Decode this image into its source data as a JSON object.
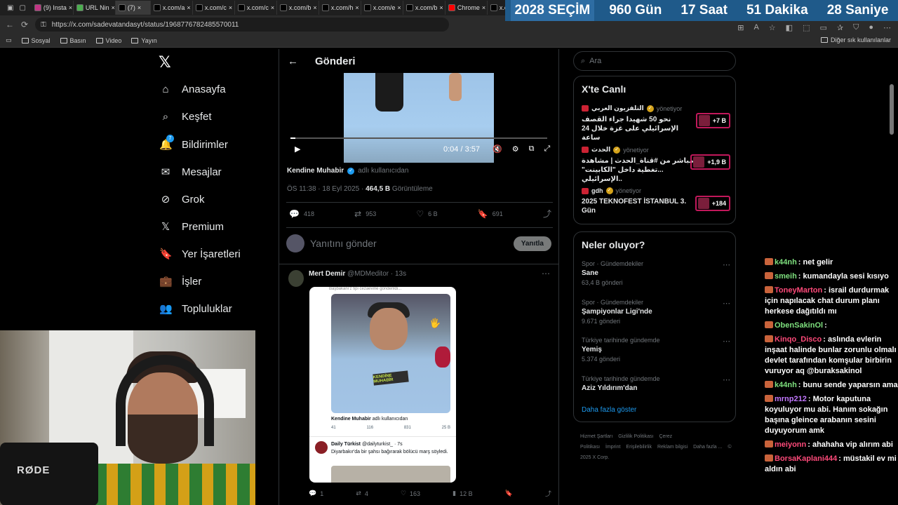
{
  "browser": {
    "tabs": [
      {
        "label": "(9) Insta",
        "color": "#c13584"
      },
      {
        "label": "URL Nin",
        "color": "#4caf50"
      },
      {
        "label": "(7)",
        "color": "#000000"
      },
      {
        "label": "x.com/a",
        "color": "#000000"
      },
      {
        "label": "x.com/c",
        "color": "#000000"
      },
      {
        "label": "x.com/c",
        "color": "#000000"
      },
      {
        "label": "x.com/b",
        "color": "#000000"
      },
      {
        "label": "x.com/h",
        "color": "#000000"
      },
      {
        "label": "x.com/e",
        "color": "#000000"
      },
      {
        "label": "x.com/b",
        "color": "#000000"
      },
      {
        "label": "Chrome",
        "color": "#ff0000"
      },
      {
        "label": "x.com/a",
        "color": "#000000"
      },
      {
        "label": "x.com/u",
        "color": "#000000"
      }
    ],
    "url": "https://x.com/sadevatandasyt/status/1968776782485570011",
    "bookmarks": [
      "Sosyal",
      "Basın",
      "Video",
      "Yayın"
    ],
    "bookmarks_other": "Diğer sık kullanılanlar"
  },
  "election": {
    "label": "2028 SEÇİM",
    "days": "960 Gün",
    "hours": "17 Saat",
    "minutes": "51 Dakika",
    "seconds": "28 Saniye"
  },
  "nav": {
    "items": [
      {
        "label": "Anasayfa",
        "icon": "home-icon",
        "glyph": "⌂"
      },
      {
        "label": "Keşfet",
        "icon": "search-icon",
        "glyph": "⌕"
      },
      {
        "label": "Bildirimler",
        "icon": "bell-icon",
        "glyph": "🔔"
      },
      {
        "label": "Mesajlar",
        "icon": "mail-icon",
        "glyph": "✉"
      },
      {
        "label": "Grok",
        "icon": "grok-icon",
        "glyph": "⊘"
      },
      {
        "label": "Premium",
        "icon": "x-premium-icon",
        "glyph": "𝕏"
      },
      {
        "label": "Yer İşaretleri",
        "icon": "bookmark-icon",
        "glyph": "🔖"
      },
      {
        "label": "İşler",
        "icon": "briefcase-icon",
        "glyph": "💼"
      },
      {
        "label": "Topluluklar",
        "icon": "people-icon",
        "glyph": "👥"
      }
    ],
    "notification_badge": "7"
  },
  "post": {
    "header": "Gönderi",
    "time": "0:04 / 3:57",
    "progress": 0.02,
    "author": "Kendine Muhabir",
    "handle_note": "adlı kullanıcıdan",
    "timestamp": "ÖS 11:38 · 18 Eyl 2025 ·",
    "views": "464,5 B",
    "views_label": "Görüntüleme",
    "replies": "418",
    "reposts": "953",
    "likes": "6 B",
    "bookmarks": "691",
    "reply_placeholder": "Yanıtını gönder",
    "reply_button": "Yanıtla"
  },
  "reply_tweet": {
    "name": "Mert Demir",
    "handle": "@MDMeditor · 13s",
    "embed_top": "Başbakanı'z tipi cezaevine gönderildi...",
    "embed_tag": "KENDİNE MUHABİR",
    "embed_author": "Kendine Muhabir",
    "embed_note": "adlı kullanıcıdan",
    "embed_stats": [
      "41",
      "116",
      "831",
      "25 B"
    ],
    "embed_quoted_name": "Daily Türkist",
    "embed_quoted_handle": "@dailyturkist_ · 7s",
    "embed_quoted_text": "Diyarbakır'da bir şahsı bağırarak bölücü marş söyledi.",
    "replies": "1",
    "reposts": "4",
    "likes": "163",
    "views": "12 B"
  },
  "sidebar": {
    "search_placeholder": "Ara",
    "live_title": "X'te Canlı",
    "live": [
      {
        "source": "التلفزيون العربي",
        "role": "yönetiyor",
        "headline": "نحو 50 شهيدا جراء القصف الإسرائيلي على غزة خلال 24 ساعة",
        "count": "+7 B"
      },
      {
        "source": "الحدث",
        "role": "yönetiyor",
        "headline": "مباشر من #قناة_الحدث | مشاهدة ...تغطية داخل \"الكابينت\" الإسرائيلي..",
        "count": "+1,9 B"
      },
      {
        "source": "gdh",
        "role": "yönetiyor",
        "headline": "2025 TEKNOFEST İSTANBUL 3. Gün",
        "count": "+184"
      }
    ],
    "trends_title": "Neler oluyor?",
    "trends": [
      {
        "category": "Spor · Gündemdekiler",
        "name": "Sane",
        "count": "63,4 B gönderi"
      },
      {
        "category": "Spor · Gündemdekiler",
        "name": "Şampiyonlar Ligi'nde",
        "count": "9.671 gönderi"
      },
      {
        "category": "Türkiye tarihinde gündemde",
        "name": "Yemiş",
        "count": "5.374 gönderi"
      },
      {
        "category": "Türkiye tarihinde gündemde",
        "name": "Aziz Yıldırım'dan",
        "count": ""
      }
    ],
    "show_more": "Daha fazla göster",
    "footer": [
      "Hizmet Şartları",
      "Gizlilik Politikası",
      "Çerez Politikası",
      "İmprint",
      "Erişilebilirlik",
      "Reklam bilgisi",
      "Daha fazla ...",
      "© 2025 X Corp."
    ]
  },
  "chat": [
    {
      "user": "k44nh",
      "color": "#7ee07e",
      "text": "net gelir"
    },
    {
      "user": "smeih",
      "color": "#7ee07e",
      "text": "kumandayla sesi kısıyo"
    },
    {
      "user": "ToneyMarton",
      "color": "#ff4a7a",
      "text": "israil durdurmak için napılacak chat durum planı herkese dağıtıldı mı"
    },
    {
      "user": "ObenSakinOl",
      "color": "#7ee07e",
      "text": ""
    },
    {
      "user": "Kinqo_Disco",
      "color": "#ff4a7a",
      "text": "aslında evlerin inşaat halinde bunlar zorunlu olmalı devlet tarafından komşular birbirin vuruyor aq @buraksakinol"
    },
    {
      "user": "k44nh",
      "color": "#7ee07e",
      "text": "bunu sende yaparsın ama"
    },
    {
      "user": "mrnp212",
      "color": "#c277ff",
      "text": "Motor kaputuna koyuluyor mu abi. Hanım sokağın başına gleince arabanın sesini duyuyorum amk"
    },
    {
      "user": "meiyonn",
      "color": "#ff4a7a",
      "text": "ahahaha vip alırım abi"
    },
    {
      "user": "BorsaKaplani444",
      "color": "#ff4a7a",
      "text": "müstakil ev mi aldın abi"
    }
  ],
  "webcam": {
    "brand": "RØDE"
  }
}
